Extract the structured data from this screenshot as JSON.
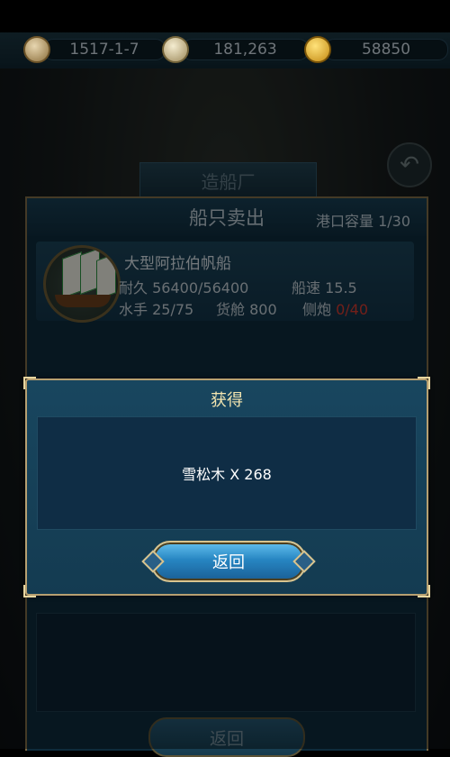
{
  "status_bar": {
    "date": "1517-1-7",
    "resource_2": "181,263",
    "gold": "58850",
    "icons": [
      "hourglass-icon",
      "gem-icon",
      "gold-coin-icon"
    ]
  },
  "background": {
    "shipyard_tab": "造船厂",
    "sell_panel": {
      "title": "船只卖出",
      "capacity_label": "港口容量",
      "capacity_value": "1/30",
      "ship": {
        "name": "大型阿拉伯帆船",
        "durability_label": "耐久",
        "durability_value": "56400/56400",
        "speed_label": "船速",
        "speed_value": "15.5",
        "crew_label": "水手",
        "crew_value": "25/75",
        "cargo_label": "货舱",
        "cargo_value": "800",
        "cannon_label": "侧炮",
        "cannon_value": "0/40"
      },
      "bottom_button_label": "返回"
    }
  },
  "modal": {
    "title": "获得",
    "reward": "雪松木 X 268",
    "button_label": "返回"
  },
  "colors": {
    "accent_gold": "#b7a071",
    "button_blue": "#2786c2",
    "warning_red": "#d23a2f"
  }
}
